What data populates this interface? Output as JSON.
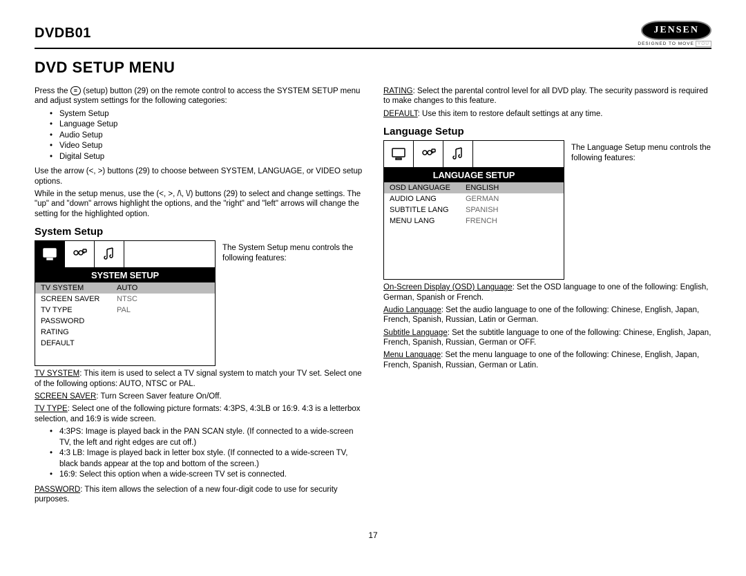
{
  "header": {
    "model": "DVDB01",
    "brand": "JENSEN",
    "tagline": "DESIGNED TO MOVE",
    "tagline_suffix": "YOU"
  },
  "title": "DVD SETUP MENU",
  "col1": {
    "intro_a": "Press the ",
    "intro_b": " (setup) button (29) on the remote control to access the SYSTEM SETUP menu and adjust system settings for the following categories:",
    "categories": [
      "System Setup",
      "Language Setup",
      "Audio Setup",
      "Video Setup",
      "Digital Setup"
    ],
    "arrows1": "Use the arrow (<, >) buttons (29) to choose between SYSTEM, LANGUAGE, or VIDEO setup options.",
    "arrows2": "While in the setup menus, use the (<, >, /\\, \\/) buttons (29) to select and change settings. The \"up\" and \"down\" arrows highlight the options, and the \"right\" and \"left\" arrows will change the setting for the highlighted option.",
    "sys_heading": "System Setup",
    "sys_note": "The System Setup menu controls the following features:",
    "sys_menu": {
      "title": "SYSTEM SETUP",
      "items": [
        {
          "k": "TV SYSTEM",
          "v": "AUTO",
          "hl": true
        },
        {
          "k": "SCREEN SAVER",
          "v": "NTSC"
        },
        {
          "k": "TV TYPE",
          "v": "PAL"
        },
        {
          "k": "PASSWORD",
          "v": ""
        },
        {
          "k": "RATING",
          "v": ""
        },
        {
          "k": "DEFAULT",
          "v": ""
        }
      ]
    },
    "desc": [
      {
        "u": "TV SYSTEM",
        "t": ": This item is used to select a TV signal system to match your TV set. Select one of the following options: AUTO, NTSC or PAL."
      },
      {
        "u": "SCREEN SAVER",
        "t": ": Turn Screen Saver feature On/Off."
      },
      {
        "u": "TV TYPE",
        "t": ": Select one of the following picture formats: 4:3PS, 4:3LB or 16:9. 4:3 is a letterbox selection, and 16:9 is wide screen."
      }
    ],
    "tvtype_bullets": [
      "4:3PS: Image is played back in the PAN SCAN style. (If connected to a wide-screen TV, the left and right edges are cut off.)",
      "4:3 LB: Image is played back in letter box style. (If connected to a wide-screen TV, black bands appear at the top and bottom of the screen.)",
      "16:9: Select this option when a wide-screen TV set is connected."
    ],
    "password": {
      "u": "PASSWORD",
      "t": ": This item allows the selection of a new four-digit code to use for security purposes."
    }
  },
  "col2": {
    "rating": {
      "u": "RATING",
      "t": ": Select the parental control level for all DVD play. The security password is required to make changes to this feature."
    },
    "default": {
      "u": "DEFAULT",
      "t": ": Use this item to restore default settings at any time."
    },
    "lang_heading": "Language Setup",
    "lang_note": "The Language Setup menu controls the following features:",
    "lang_menu": {
      "title": "LANGUAGE SETUP",
      "items": [
        {
          "k": "OSD LANGUAGE",
          "v": "ENGLISH",
          "hl": true,
          "sel": true
        },
        {
          "k": "AUDIO LANG",
          "v": "GERMAN"
        },
        {
          "k": "SUBTITLE LANG",
          "v": "SPANISH"
        },
        {
          "k": "MENU LANG",
          "v": "FRENCH"
        }
      ]
    },
    "desc": [
      {
        "u": "On-Screen Display (OSD) Language",
        "t": ": Set the OSD language to one of the following: English, German, Spanish or French."
      },
      {
        "u": "Audio Language",
        "t": ": Set the audio language to one of the following: Chinese, English, Japan, French, Spanish, Russian, Latin or German."
      },
      {
        "u": "Subtitle Language",
        "t": ": Set the subtitle language to one of the following: Chinese, English, Japan, French, Spanish, Russian, German or OFF."
      },
      {
        "u": "Menu Language",
        "t": ": Set the menu language to one of the following: Chinese, English, Japan, French, Spanish, Russian, German or Latin."
      }
    ]
  },
  "pagenum": "17"
}
